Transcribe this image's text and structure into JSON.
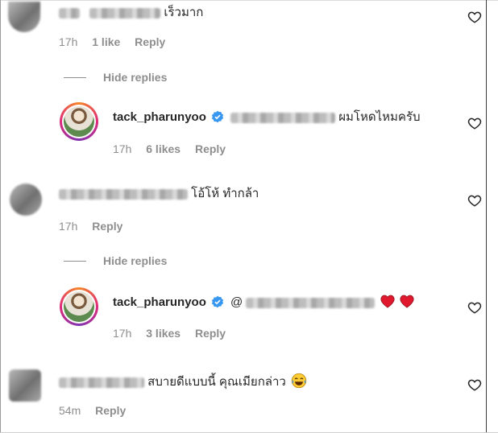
{
  "comments": [
    {
      "id": "c1",
      "text": "เร็วมาก",
      "time": "17h",
      "likes": "1 like",
      "reply": "Reply"
    },
    {
      "id": "r1",
      "username": "tack_pharunyoo",
      "text": "ผมโหดไหมครับ",
      "time": "17h",
      "likes": "6 likes",
      "reply": "Reply"
    },
    {
      "id": "c2",
      "text": "โอ้โห้ ทำกล้า",
      "time": "17h",
      "reply": "Reply"
    },
    {
      "id": "r2",
      "username": "tack_pharunyoo",
      "mention_prefix": "@",
      "time": "17h",
      "likes": "3 likes",
      "reply": "Reply"
    },
    {
      "id": "c3",
      "text": "สบายดีแบบนี้ คุณเมียกล่าว",
      "time": "54m",
      "reply": "Reply"
    }
  ],
  "hide_replies_label": "Hide replies",
  "icons": {
    "like": "heart-outline-icon",
    "verified": "verified-badge-icon",
    "red_heart": "red-heart-emoji",
    "laugh": "tears-of-joy-emoji"
  },
  "colors": {
    "verified": "#3897f0",
    "meta": "#8e8e8e",
    "text": "#262626",
    "red_heart": "#e0182d"
  }
}
